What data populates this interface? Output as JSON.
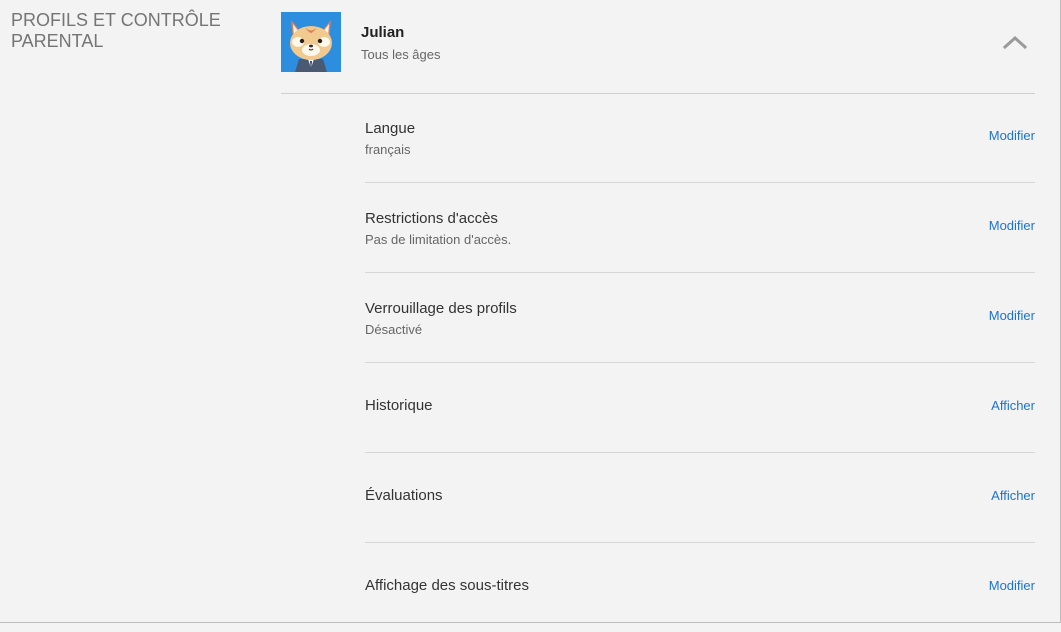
{
  "section": {
    "title": "PROFILS ET CONTRÔLE PARENTAL"
  },
  "profile": {
    "name": "Julian",
    "maturity": "Tous les âges",
    "avatar_icon": "red-panda-avatar-icon",
    "collapse_icon": "chevron-up-icon"
  },
  "settings": [
    {
      "title": "Langue",
      "description": "français",
      "action": "Modifier"
    },
    {
      "title": "Restrictions d'accès",
      "description": "Pas de limitation d'accès.",
      "action": "Modifier"
    },
    {
      "title": "Verrouillage des profils",
      "description": "Désactivé",
      "action": "Modifier"
    },
    {
      "title": "Historique",
      "description": "",
      "action": "Afficher"
    },
    {
      "title": "Évaluations",
      "description": "",
      "action": "Afficher"
    },
    {
      "title": "Affichage des sous-titres",
      "description": "",
      "action": "Modifier"
    }
  ],
  "colors": {
    "background": "#f3f3f3",
    "link": "#1a73d9",
    "avatar_bg": "#2d8ee0"
  }
}
